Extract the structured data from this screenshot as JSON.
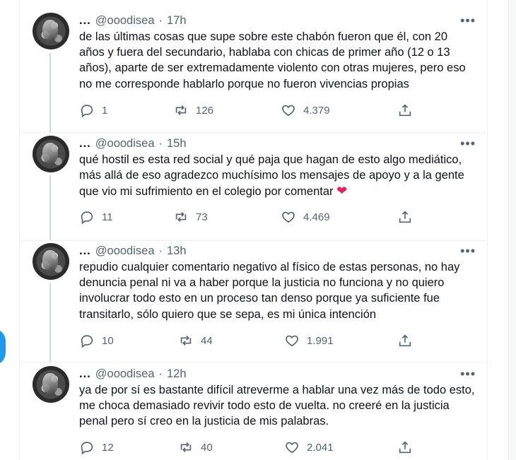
{
  "tweets": [
    {
      "name": "...",
      "handle": "@ooodisea",
      "sep": "·",
      "time": "17h",
      "text": "de las últimas cosas que supe sobre este chabón fueron que él, con 20 años y fuera del secundario, hablaba con chicas de primer año (12 o 13 años), aparte de ser extremadamente violento con otras mujeres, pero eso no me corresponde hablarlo porque no fueron vivencias propias",
      "replies": "1",
      "retweets": "126",
      "likes": "4.379"
    },
    {
      "name": "...",
      "handle": "@ooodisea",
      "sep": "·",
      "time": "15h",
      "text": "qué hostil es esta red social y qué paja que hagan de esto algo mediático, más allá de eso agradezco muchísimo los mensajes de apoyo y a la gente que vio mi sufrimiento en el colegio por comentar",
      "emoji": "❤",
      "replies": "11",
      "retweets": "73",
      "likes": "4.469"
    },
    {
      "name": "...",
      "handle": "@ooodisea",
      "sep": "·",
      "time": "13h",
      "text": "repudio cualquier comentario negativo al físico de estas personas, no hay denuncia penal ni va a haber porque la justicia no funciona y no quiero involucrar todo esto en un proceso tan denso porque ya suficiente fue transitarlo, sólo quiero que se sepa, es mi única intención",
      "replies": "10",
      "retweets": "44",
      "likes": "1.991"
    },
    {
      "name": "...",
      "handle": "@ooodisea",
      "sep": "·",
      "time": "12h",
      "text": "ya de por sí es bastante difícil atreverme a hablar una vez más de todo esto, me choca demasiado revivir todo esto de vuelta. no creeré en la justicia penal pero sí creo en la justicia de mis palabras.",
      "replies": "12",
      "retweets": "40",
      "likes": "2.041"
    }
  ],
  "ui": {
    "more_label": "•••",
    "accent_color": "#1d9bf0",
    "text_color": "#0f1419",
    "muted_color": "#536471",
    "icons": [
      "reply-icon",
      "retweet-icon",
      "like-icon",
      "share-icon",
      "more-icon"
    ]
  }
}
